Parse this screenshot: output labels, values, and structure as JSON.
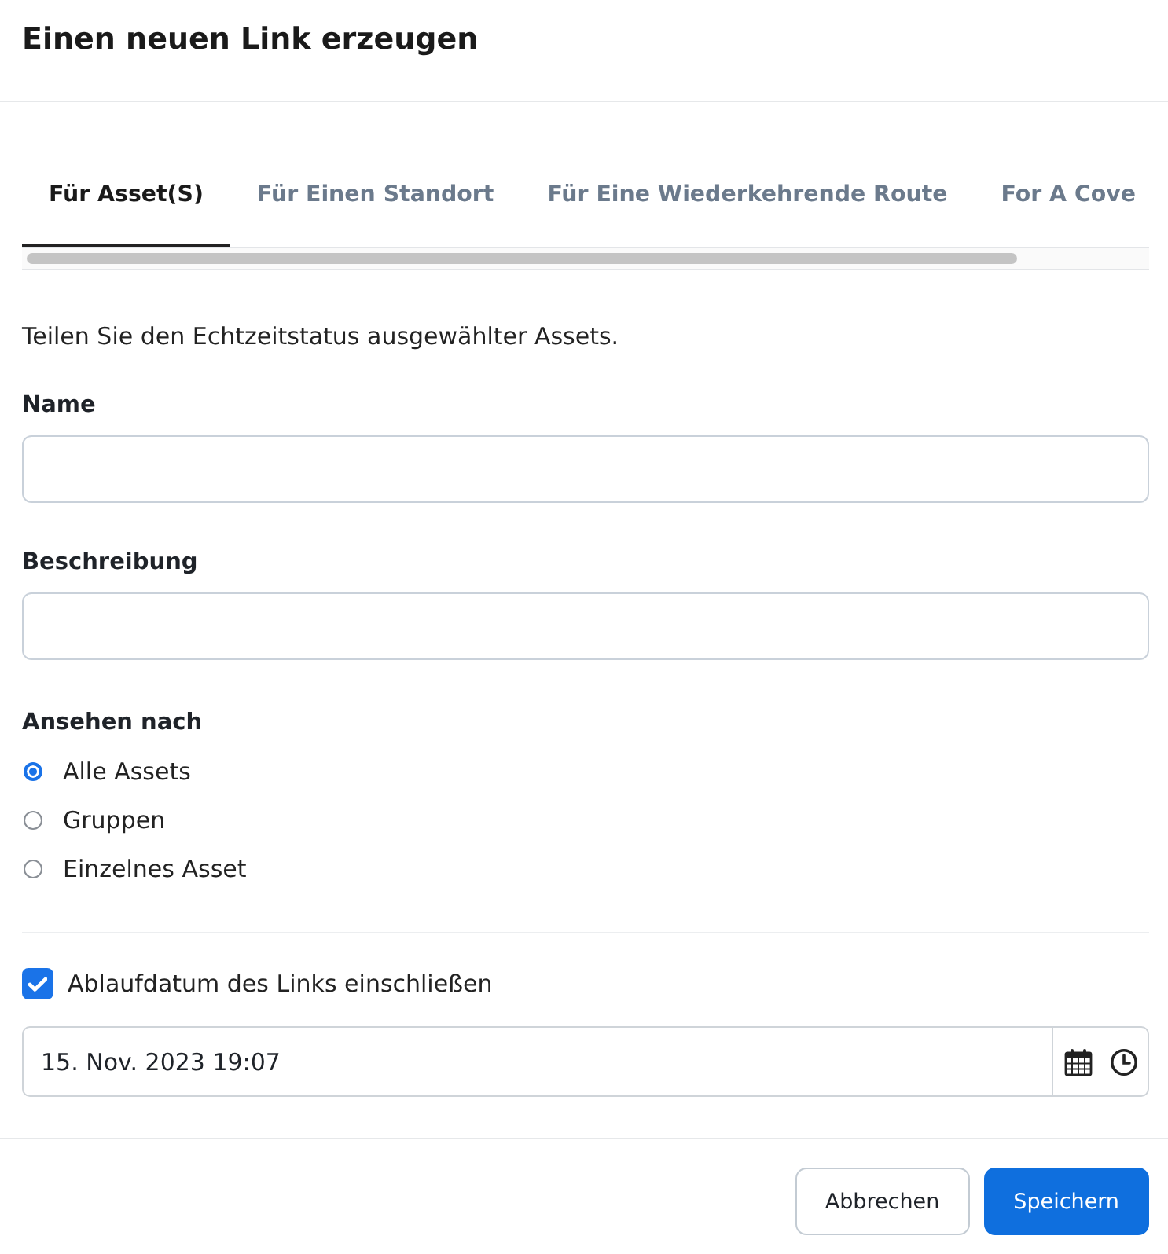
{
  "dialog": {
    "title": "Einen neuen Link erzeugen"
  },
  "tabs": [
    {
      "label": "Für Asset(S)",
      "selected": true
    },
    {
      "label": "Für Einen Standort",
      "selected": false
    },
    {
      "label": "Für Eine Wiederkehrende Route",
      "selected": false
    },
    {
      "label": "For A Cove",
      "selected": false
    }
  ],
  "description": "Teilen Sie den Echtzeitstatus ausgewählter Assets.",
  "fields": [
    {
      "label": "Name"
    },
    {
      "label": "Beschreibung"
    }
  ],
  "view_by": {
    "label": "Ansehen nach",
    "options": [
      {
        "label": "Alle Assets",
        "selected": true
      },
      {
        "label": "Gruppen",
        "selected": false
      },
      {
        "label": "Einzelnes Asset",
        "selected": false
      }
    ]
  },
  "expiry": {
    "label": "Ablaufdatum des Links einschließen",
    "checked": true,
    "value": "15. Nov. 2023 19:07"
  },
  "buttons": [
    {
      "label": "Abbrechen",
      "kind": "secondary"
    },
    {
      "label": "Speichern",
      "kind": "primary"
    }
  ]
}
